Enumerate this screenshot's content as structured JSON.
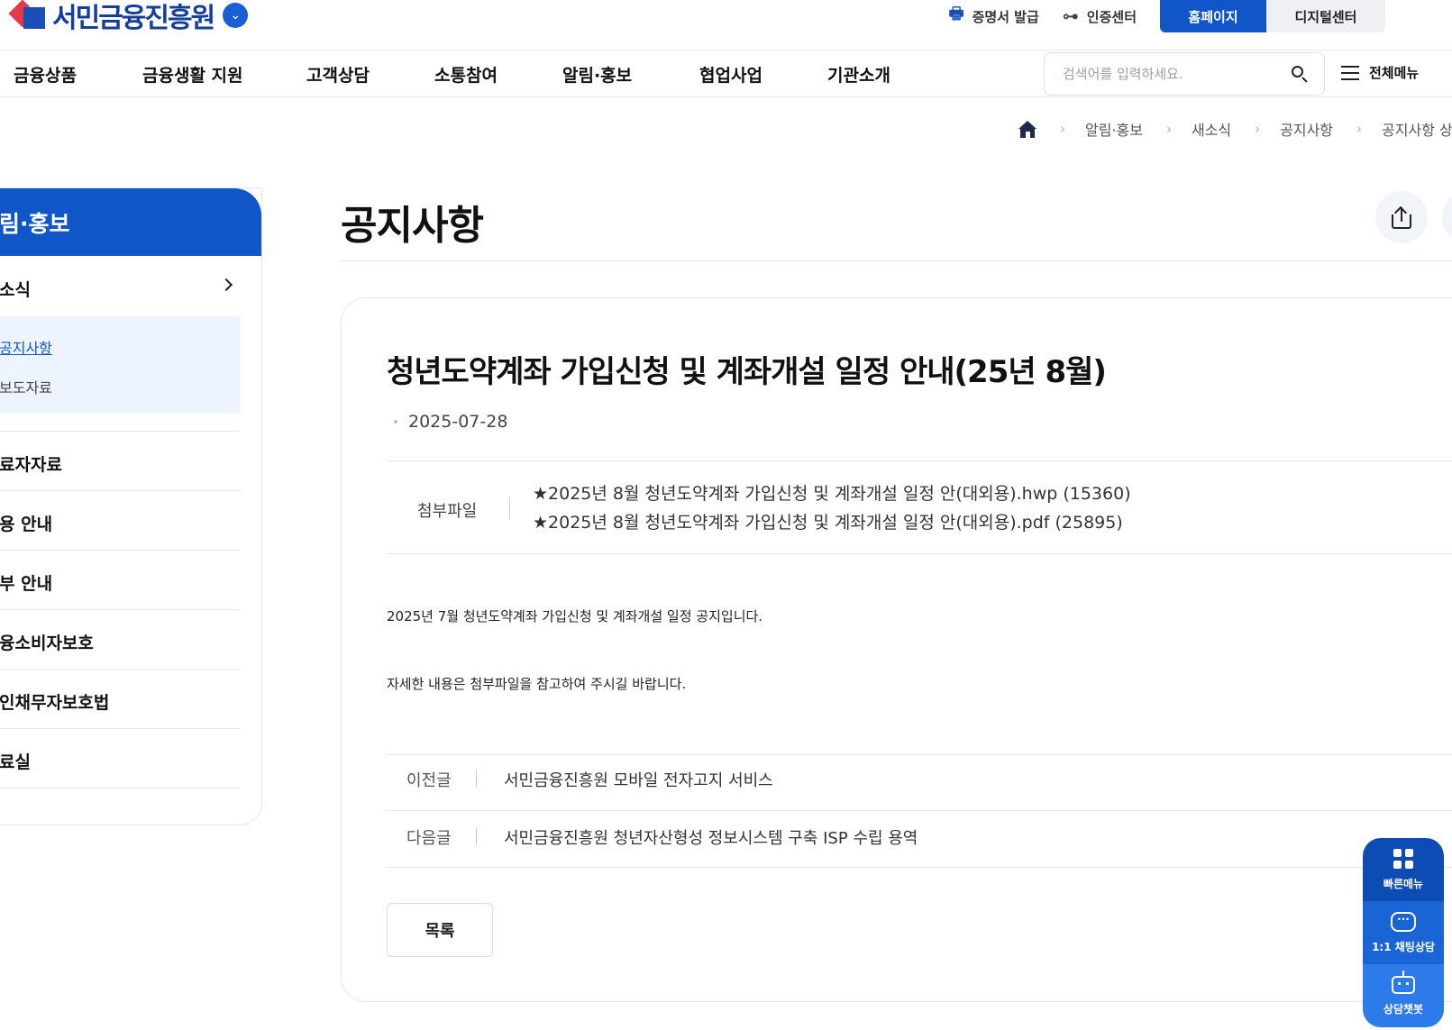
{
  "header": {
    "logo_text": "서민금융진흥원",
    "utility": {
      "certificate": "증명서 발급",
      "auth_center": "인증센터",
      "homepage": "홈페이지",
      "digital_center": "디지털센터"
    },
    "gnb": [
      "금융상품",
      "금융생활 지원",
      "고객상담",
      "소통참여",
      "알림·홍보",
      "협업사업",
      "기관소개"
    ],
    "search": {
      "placeholder": "검색어를 입력하세요.",
      "value": ""
    },
    "all_menu": "전체메뉴"
  },
  "breadcrumb": [
    "알림·홍보",
    "새소식",
    "공지사항",
    "공지사항 상"
  ],
  "sidebar": {
    "title": "림·홍보",
    "items": [
      {
        "label": "소식"
      },
      {
        "label": "료자자료"
      },
      {
        "label": "용 안내"
      },
      {
        "label": "부 안내"
      },
      {
        "label": "융소비자보호"
      },
      {
        "label": "인채무자보호법"
      },
      {
        "label": "료실"
      }
    ],
    "sub_items": [
      "공지사항",
      "보도자료"
    ]
  },
  "main": {
    "page_title": "공지사항",
    "post": {
      "title": "청년도약계좌 가입신청 및 계좌개설 일정 안내(25년 8월)",
      "date": "2025-07-28",
      "attachment_label": "첨부파일",
      "attachments": [
        "★2025년 8월 청년도약계좌 가입신청 및 계좌개설 일정 안(대외용).hwp (15360)",
        "★2025년 8월 청년도약계좌 가입신청 및 계좌개설 일정 안(대외용).pdf (25895)"
      ],
      "body": [
        "2025년 7월 청년도약계좌 가입신청 및 계좌개설 일정 공지입니다.",
        "자세한 내용은 첨부파일을 참고하여 주시길 바랍니다."
      ]
    },
    "prev": {
      "label": "이전글",
      "title": "서민금융진흥원 모바일 전자고지 서비스"
    },
    "next": {
      "label": "다음글",
      "title": "서민금융진흥원 청년자산형성 정보시스템 구축 ISP 수립 용역"
    },
    "list_button": "목록"
  },
  "quick_menu": {
    "quick": "빠른메뉴",
    "chat": "1:1 채팅상담",
    "bot": "상담챗봇"
  }
}
